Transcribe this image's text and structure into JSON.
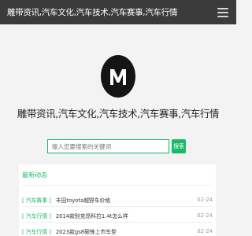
{
  "header": {
    "title": "雕带资讯,汽车文化,汽车技术,汽车赛事,汽车行情",
    "menu_icon": "hamburger-menu-icon"
  },
  "hero": {
    "logo_icon": "m-logo-icon",
    "slogan": "雕带资讯,汽车文化,汽车技术,汽车赛事,汽车行情"
  },
  "search": {
    "placeholder": "输入您要搜索的关键词",
    "button_label": "搜索"
  },
  "latest": {
    "title": "最新动态",
    "items": [
      {
        "category": "[ 汽车赛事 ]",
        "title": "丰田toyota越野车价格",
        "date": "02-24"
      },
      {
        "category": "[ 汽车行情 ]",
        "title": "2014款别克昂科拉1.4t怎么样",
        "date": "02-24"
      },
      {
        "category": "[ 汽车行情 ]",
        "title": "2023款gs8砸锋上市车型",
        "date": "02-24"
      }
    ]
  },
  "colors": {
    "accent": "#19b96a",
    "topbar": "#3b3b3b",
    "page_background": "#f3f3f3"
  }
}
